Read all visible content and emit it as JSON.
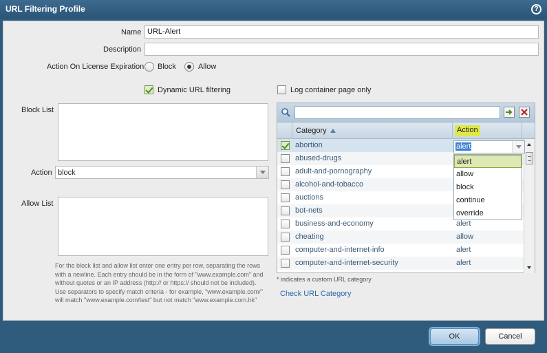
{
  "dialog": {
    "title": "URL Filtering Profile",
    "help_icon": "?"
  },
  "form": {
    "name_label": "Name",
    "name_value": "URL-Alert",
    "description_label": "Description",
    "description_value": "",
    "license_label": "Action On License Expiration",
    "license_options": [
      {
        "label": "Block",
        "selected": false
      },
      {
        "label": "Allow",
        "selected": true
      }
    ],
    "dynamic_filtering_label": "Dynamic URL filtering",
    "dynamic_filtering_checked": true,
    "log_container_label": "Log container page only",
    "log_container_checked": false,
    "block_list_label": "Block List",
    "action_label": "Action",
    "action_value": "block",
    "allow_list_label": "Allow List",
    "help_text": "For the block list and allow list enter one entry per row, separating the rows with a newline. Each entry should be in the form of \"www.example.com\" and without quotes or an IP address (http:// or https:// should not be included). Use separators to specify match criteria - for example, \"www.example.com/\" will match \"www.example.com/test\" but not match \"www.example.com.hk\""
  },
  "categories": {
    "search_value": "",
    "apply_icon": "➔",
    "clear_icon": "✕",
    "header_category": "Category",
    "header_action": "Action",
    "rows": [
      {
        "category": "abortion",
        "action": "alert",
        "checked": true
      },
      {
        "category": "abused-drugs",
        "action": "",
        "checked": false
      },
      {
        "category": "adult-and-pornography",
        "action": "",
        "checked": false
      },
      {
        "category": "alcohol-and-tobacco",
        "action": "",
        "checked": false
      },
      {
        "category": "auctions",
        "action": "",
        "checked": false
      },
      {
        "category": "bot-nets",
        "action": "",
        "checked": false
      },
      {
        "category": "business-and-economy",
        "action": "alert",
        "checked": false
      },
      {
        "category": "cheating",
        "action": "allow",
        "checked": false
      },
      {
        "category": "computer-and-internet-info",
        "action": "alert",
        "checked": false
      },
      {
        "category": "computer-and-internet-security",
        "action": "alert",
        "checked": false
      }
    ],
    "editor_value": "alert",
    "dropdown_options": [
      "alert",
      "allow",
      "block",
      "continue",
      "override"
    ],
    "footnote": "* indicates a custom URL category",
    "check_link": "Check URL Category"
  },
  "footer": {
    "ok_label": "OK",
    "cancel_label": "Cancel"
  }
}
